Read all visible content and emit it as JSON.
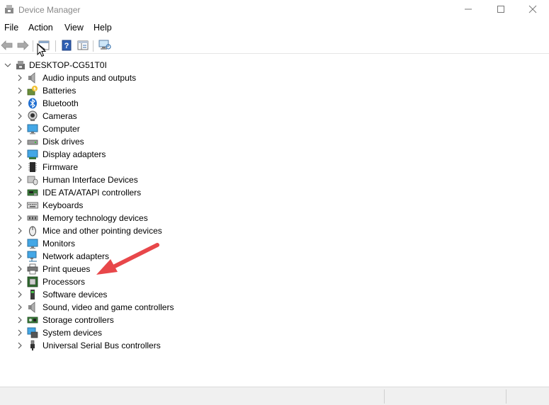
{
  "window": {
    "title": "Device Manager",
    "icon": "device-manager-icon",
    "controls": {
      "minimize": "minimize-icon",
      "maximize": "maximize-icon",
      "close": "close-icon"
    }
  },
  "menu": {
    "file": "File",
    "action": "Action",
    "view": "View",
    "help": "Help"
  },
  "toolbar": {
    "buttons": [
      "back-icon",
      "forward-icon",
      "properties-icon",
      "help-icon",
      "console-tree-icon",
      "scan-hardware-icon"
    ]
  },
  "tree": {
    "root": {
      "label": "DESKTOP-CG51T0I",
      "icon": "computer-icon",
      "expanded": true
    },
    "categories": [
      {
        "label": "Audio inputs and outputs",
        "icon": "speaker-icon"
      },
      {
        "label": "Batteries",
        "icon": "battery-icon"
      },
      {
        "label": "Bluetooth",
        "icon": "bluetooth-icon"
      },
      {
        "label": "Cameras",
        "icon": "camera-icon"
      },
      {
        "label": "Computer",
        "icon": "monitor-icon"
      },
      {
        "label": "Disk drives",
        "icon": "disk-drive-icon"
      },
      {
        "label": "Display adapters",
        "icon": "display-adapter-icon"
      },
      {
        "label": "Firmware",
        "icon": "chip-icon"
      },
      {
        "label": "Human Interface Devices",
        "icon": "hid-icon"
      },
      {
        "label": "IDE ATA/ATAPI controllers",
        "icon": "ide-controller-icon"
      },
      {
        "label": "Keyboards",
        "icon": "keyboard-icon"
      },
      {
        "label": "Memory technology devices",
        "icon": "memory-icon"
      },
      {
        "label": "Mice and other pointing devices",
        "icon": "mouse-icon"
      },
      {
        "label": "Monitors",
        "icon": "monitor-icon"
      },
      {
        "label": "Network adapters",
        "icon": "network-icon"
      },
      {
        "label": "Print queues",
        "icon": "printer-icon"
      },
      {
        "label": "Processors",
        "icon": "processor-icon"
      },
      {
        "label": "Software devices",
        "icon": "software-device-icon"
      },
      {
        "label": "Sound, video and game controllers",
        "icon": "speaker-icon"
      },
      {
        "label": "Storage controllers",
        "icon": "storage-controller-icon"
      },
      {
        "label": "System devices",
        "icon": "system-device-icon"
      },
      {
        "label": "Universal Serial Bus controllers",
        "icon": "usb-icon"
      }
    ]
  },
  "colors": {
    "accent": "#1a73c8",
    "annotation_arrow": "#e8474a"
  }
}
